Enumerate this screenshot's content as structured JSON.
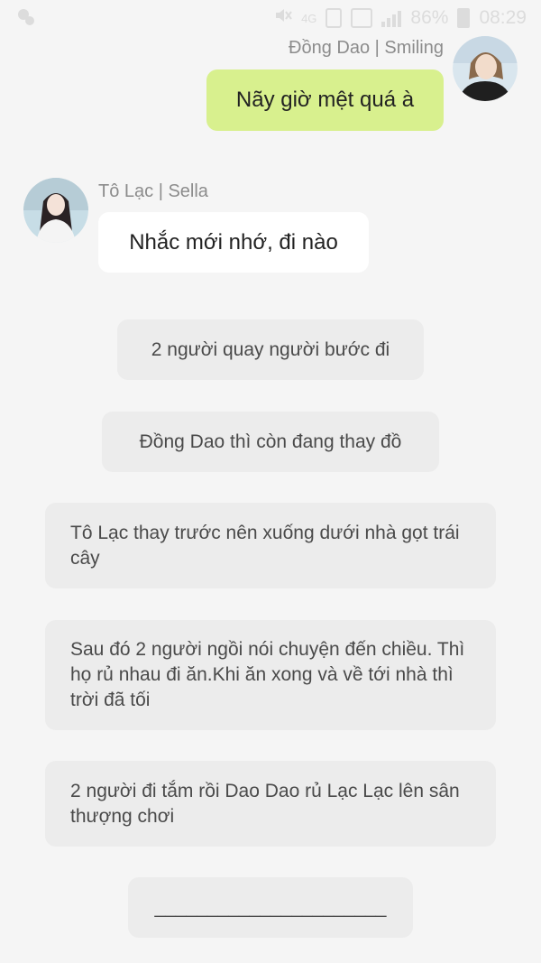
{
  "status_bar": {
    "network": "4G",
    "battery": "86%",
    "time": "08:29"
  },
  "messages": [
    {
      "sender": "Đồng Dao | Smiling",
      "text": "Nãy giờ mệt quá à"
    },
    {
      "sender": "Tô Lạc | Sella",
      "text": "Nhắc mới nhớ, đi nào"
    }
  ],
  "narrations": [
    "2 người quay người bước đi",
    "Đồng Dao thì còn đang thay đồ",
    "Tô Lạc thay trước nên xuống dưới nhà gọt trái cây",
    "Sau đó 2 người ngồi nói chuyện đến chiều. Thì họ rủ nhau đi ăn.Khi ăn xong và về tới nhà thì trời đã tối",
    "2 người đi tắm rồi Dao Dao rủ Lạc Lạc lên sân thượng chơi",
    "______________________"
  ],
  "colors": {
    "background": "#f5f5f5",
    "outgoing_bubble": "#d8f08e",
    "incoming_bubble": "#ffffff",
    "narration_bubble": "#ececec"
  }
}
